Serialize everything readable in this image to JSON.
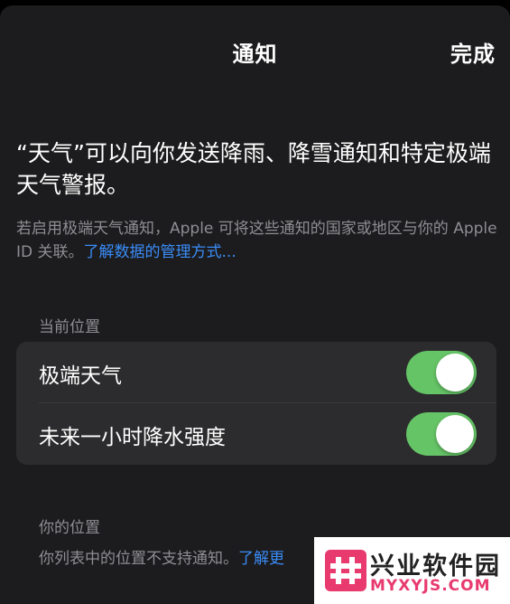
{
  "header": {
    "title": "通知",
    "done_label": "完成"
  },
  "intro": {
    "headline": "“天气”可以向你发送降雨、降雪通知和特定极端天气警报。",
    "info_text": "若启用极端天气通知，Apple 可将这些通知的国家或地区与你的 Apple ID 关联。",
    "info_link": "了解数据的管理方式..."
  },
  "current_location": {
    "section_label": "当前位置",
    "items": [
      {
        "label": "极端天气",
        "enabled": true
      },
      {
        "label": "未来一小时降水强度",
        "enabled": true
      }
    ]
  },
  "your_locations": {
    "section_label": "你的位置",
    "text": "你列表中的位置不支持通知。",
    "link": "了解更"
  },
  "watermark": {
    "title": "兴业软件园",
    "subtitle": "MYXYJS.COM"
  },
  "colors": {
    "sheet_bg": "#1c1c1e",
    "group_bg": "#2c2c2e",
    "toggle_on": "#65c466",
    "link": "#3a8cf7",
    "secondary_text": "#8e8e93"
  }
}
